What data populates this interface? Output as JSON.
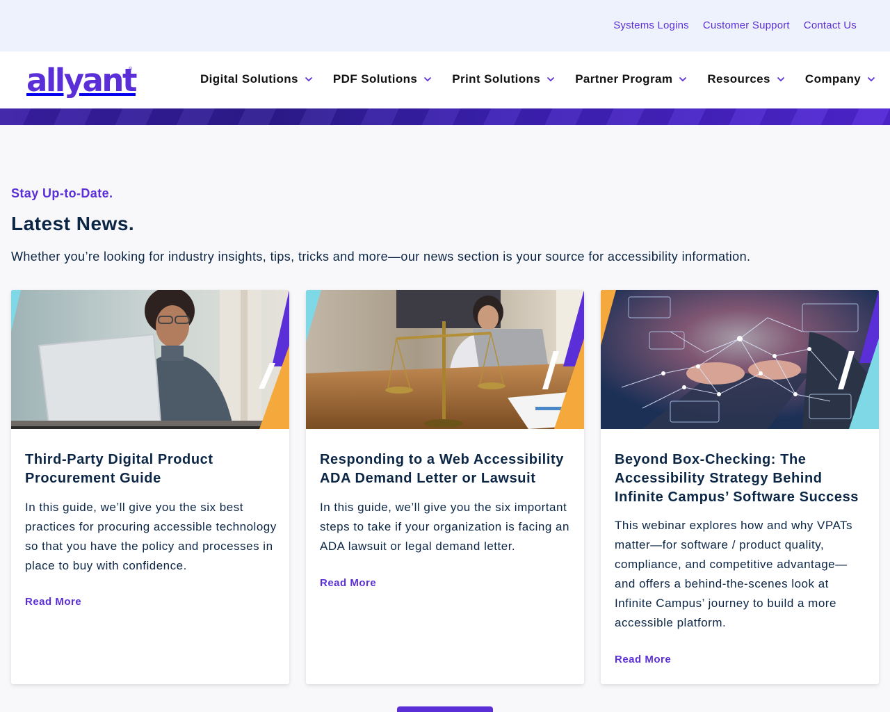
{
  "utility": {
    "links": [
      "Systems Logins",
      "Customer Support",
      "Contact Us"
    ]
  },
  "header": {
    "logo_text": "allyant",
    "logo_mark": "®",
    "nav": [
      {
        "label": "Digital Solutions",
        "icon": "chevron-down-icon"
      },
      {
        "label": "PDF Solutions",
        "icon": "chevron-down-icon"
      },
      {
        "label": "Print Solutions",
        "icon": "chevron-down-icon"
      },
      {
        "label": "Partner Program",
        "icon": "chevron-down-icon"
      },
      {
        "label": "Resources",
        "icon": "chevron-down-icon"
      },
      {
        "label": "Company",
        "icon": "chevron-down-icon"
      }
    ]
  },
  "news": {
    "eyebrow": "Stay Up-to-Date.",
    "title": "Latest News.",
    "description": "Whether you’re looking for industry insights, tips, tricks and more—our news section is your source for accessibility information.",
    "cards": [
      {
        "title": "Third-Party Digital Product Procurement Guide",
        "excerpt": "In this guide, we’ll give you the six best practices for procuring accessible technology so that you have the policy and processes in place to buy with confidence.",
        "link": "Read More"
      },
      {
        "title": "Responding to a Web Accessibility ADA Demand Letter or Lawsuit",
        "excerpt": "In this guide, we’ll give you the six important steps to take if your organization is facing an ADA lawsuit or legal demand letter.",
        "link": "Read More"
      },
      {
        "title": "Beyond Box-Checking: The Accessibility Strategy Behind Infinite Campus’ Software Success",
        "excerpt": "This webinar explores how and why VPATs matter—for software / product quality, compliance, and competitive advantage—and offers a behind-the-scenes look at Infinite Campus’ journey to build a more accessible platform.",
        "link": "Read More"
      }
    ]
  },
  "colors": {
    "brand_purple": "#5b2fd8",
    "navy_text": "#0b2545",
    "accent_orange": "#f5a93c",
    "accent_cyan": "#7fd8e6"
  }
}
